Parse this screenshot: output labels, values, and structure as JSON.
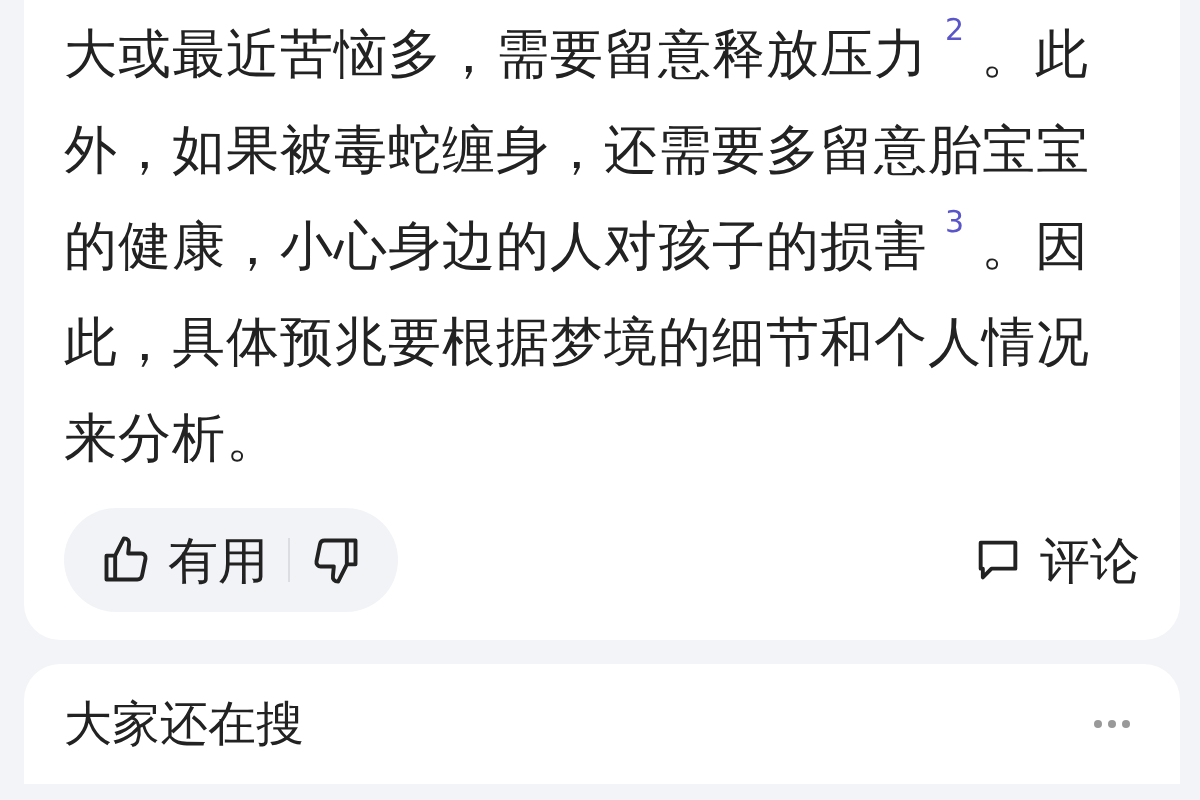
{
  "answer": {
    "text": "大或最近苦恼多，需要留意释放压力 $^{2}$ 。此外，如果被毒蛇缠身，还需要多留意胎宝宝的健康，小心身边的人对孩子的损害 $^{3}$ 。因此，具体预兆要根据梦境的细节和个人情况来分析。"
  },
  "feedback": {
    "useful_label": "有用",
    "comment_label": "评论"
  },
  "related": {
    "title": "大家还在搜"
  }
}
